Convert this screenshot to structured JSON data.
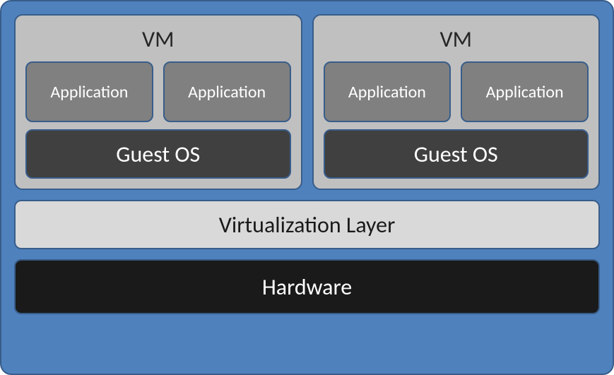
{
  "diagram": {
    "vms": [
      {
        "title": "VM",
        "apps": [
          "Application",
          "Application"
        ],
        "guest_os": "Guest OS"
      },
      {
        "title": "VM",
        "apps": [
          "Application",
          "Application"
        ],
        "guest_os": "Guest OS"
      }
    ],
    "virtualization_layer": "Virtualization Layer",
    "hardware": "Hardware"
  },
  "colors": {
    "outer_bg": "#4f81bd",
    "border": "#385d8a",
    "vm_bg": "#c0c0c0",
    "app_bg": "#808080",
    "guest_os_bg": "#404040",
    "virt_bg": "#d9d9d9",
    "hardware_bg": "#1a1a1a"
  }
}
